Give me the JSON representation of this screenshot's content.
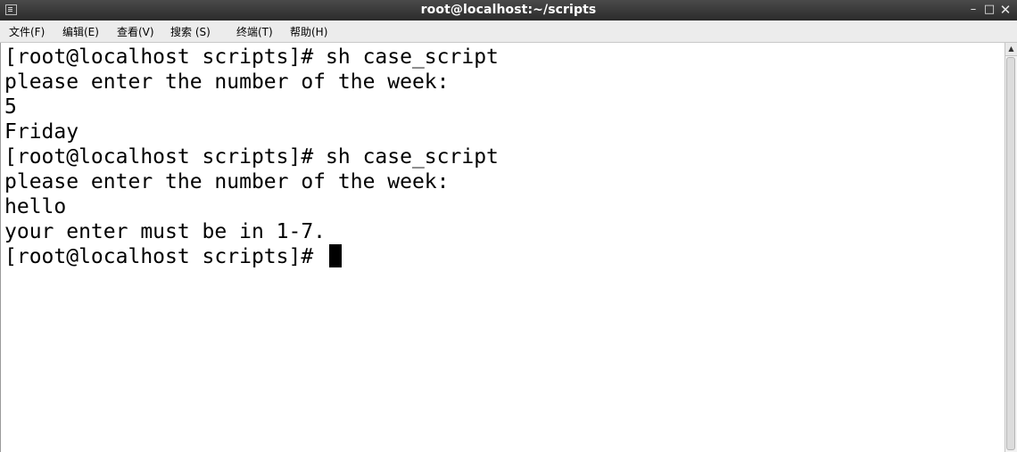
{
  "window": {
    "title": "root@localhost:~/scripts",
    "minimize_glyph": "–",
    "maximize_glyph": "□",
    "close_glyph": "✕"
  },
  "menu": {
    "items": [
      {
        "label": "文件(F)"
      },
      {
        "label": "编辑(E)"
      },
      {
        "label": "查看(V)"
      },
      {
        "label": "搜索 (S)"
      },
      {
        "label": "终端(T)"
      },
      {
        "label": "帮助(H)"
      }
    ]
  },
  "terminal": {
    "lines": [
      "[root@localhost scripts]# sh case_script",
      "please enter the number of the week:",
      "5",
      "Friday",
      "[root@localhost scripts]# sh case_script",
      "please enter the number of the week:",
      "hello",
      "your enter must be in 1-7.",
      "[root@localhost scripts]# "
    ]
  },
  "scrollbar": {
    "up_glyph": "▲"
  },
  "icons": {
    "app": "terminal-icon",
    "cursor": "block-cursor"
  }
}
